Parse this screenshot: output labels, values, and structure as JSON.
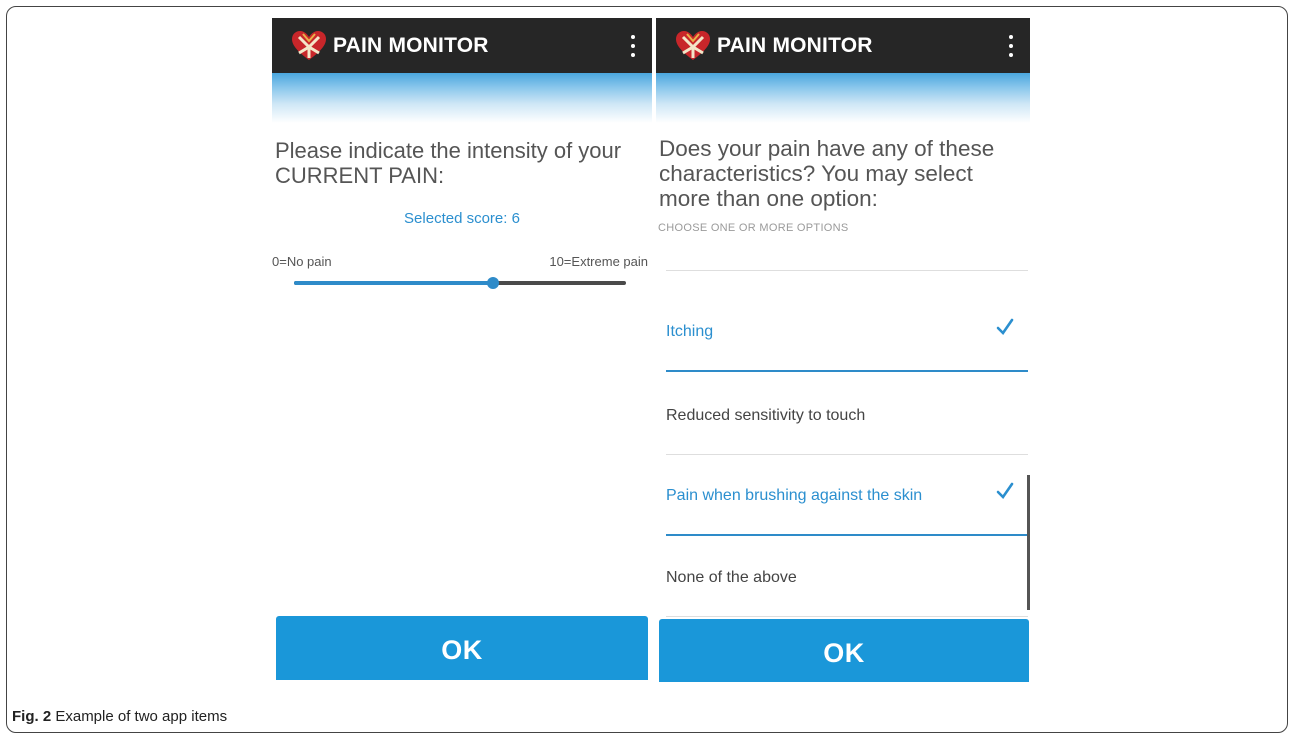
{
  "left_screen": {
    "app_title": "PAIN MONITOR",
    "question": "Please indicate the intensity of your CURRENT PAIN:",
    "selected_score": "Selected score: 6",
    "scale_min_label": "0=No pain",
    "scale_max_label": "10=Extreme pain",
    "slider": {
      "min": 0,
      "max": 10,
      "value": 6
    },
    "ok_label": "OK"
  },
  "right_screen": {
    "app_title": "PAIN MONITOR",
    "question": "Does your pain have any of these characteristics? You may select more than one option:",
    "hint": "CHOOSE ONE OR MORE OPTIONS",
    "options": [
      {
        "label": "Itching",
        "selected": true
      },
      {
        "label": "Reduced sensitivity to touch",
        "selected": false
      },
      {
        "label": "Pain when brushing against the skin",
        "selected": true
      },
      {
        "label": "None of the above",
        "selected": false
      }
    ],
    "ok_label": "OK"
  },
  "caption": {
    "figure_label": "Fig. 2",
    "text": "Example of two app items"
  },
  "colors": {
    "appbar": "#262626",
    "accent": "#1a97d9",
    "selected_text": "#2b8fcf"
  },
  "icons": [
    "app-logo-icon",
    "overflow-menu-icon",
    "checkmark-icon"
  ]
}
